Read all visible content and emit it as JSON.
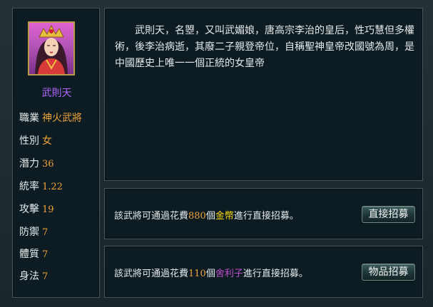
{
  "general": {
    "name": "武則天",
    "description": "武則天，名曌，又叫武媚娘，唐高宗李治的皇后，性巧慧但多權術，後李治病逝，其廢二子親登帝位，自稱聖神皇帝改國號為周，是中國歷史上唯一一個正統的女皇帝",
    "stats": [
      {
        "label": "職業",
        "value": "神火武將"
      },
      {
        "label": "性別",
        "value": "女"
      },
      {
        "label": "潛力",
        "value": "36"
      },
      {
        "label": "統率",
        "value": "1.22"
      },
      {
        "label": "攻擊",
        "value": "19"
      },
      {
        "label": "防禦",
        "value": "7"
      },
      {
        "label": "體質",
        "value": "7"
      },
      {
        "label": "身法",
        "value": "7"
      }
    ]
  },
  "recruit_gold": {
    "prefix": "該武將可通過花費",
    "amount": "880",
    "unit": "個",
    "currency": "金幣",
    "suffix": "進行直接招募。",
    "button_label": "直接招募"
  },
  "recruit_item": {
    "prefix": "該武將可通過花費",
    "amount": "110",
    "unit": "個",
    "item": "舍利子",
    "suffix": "進行直接招募。",
    "button_label": "物品招募"
  },
  "colors": {
    "name": "#b266ff",
    "value": "#f0a33a",
    "currency": "#ffd800",
    "item": "#c04ecb"
  }
}
